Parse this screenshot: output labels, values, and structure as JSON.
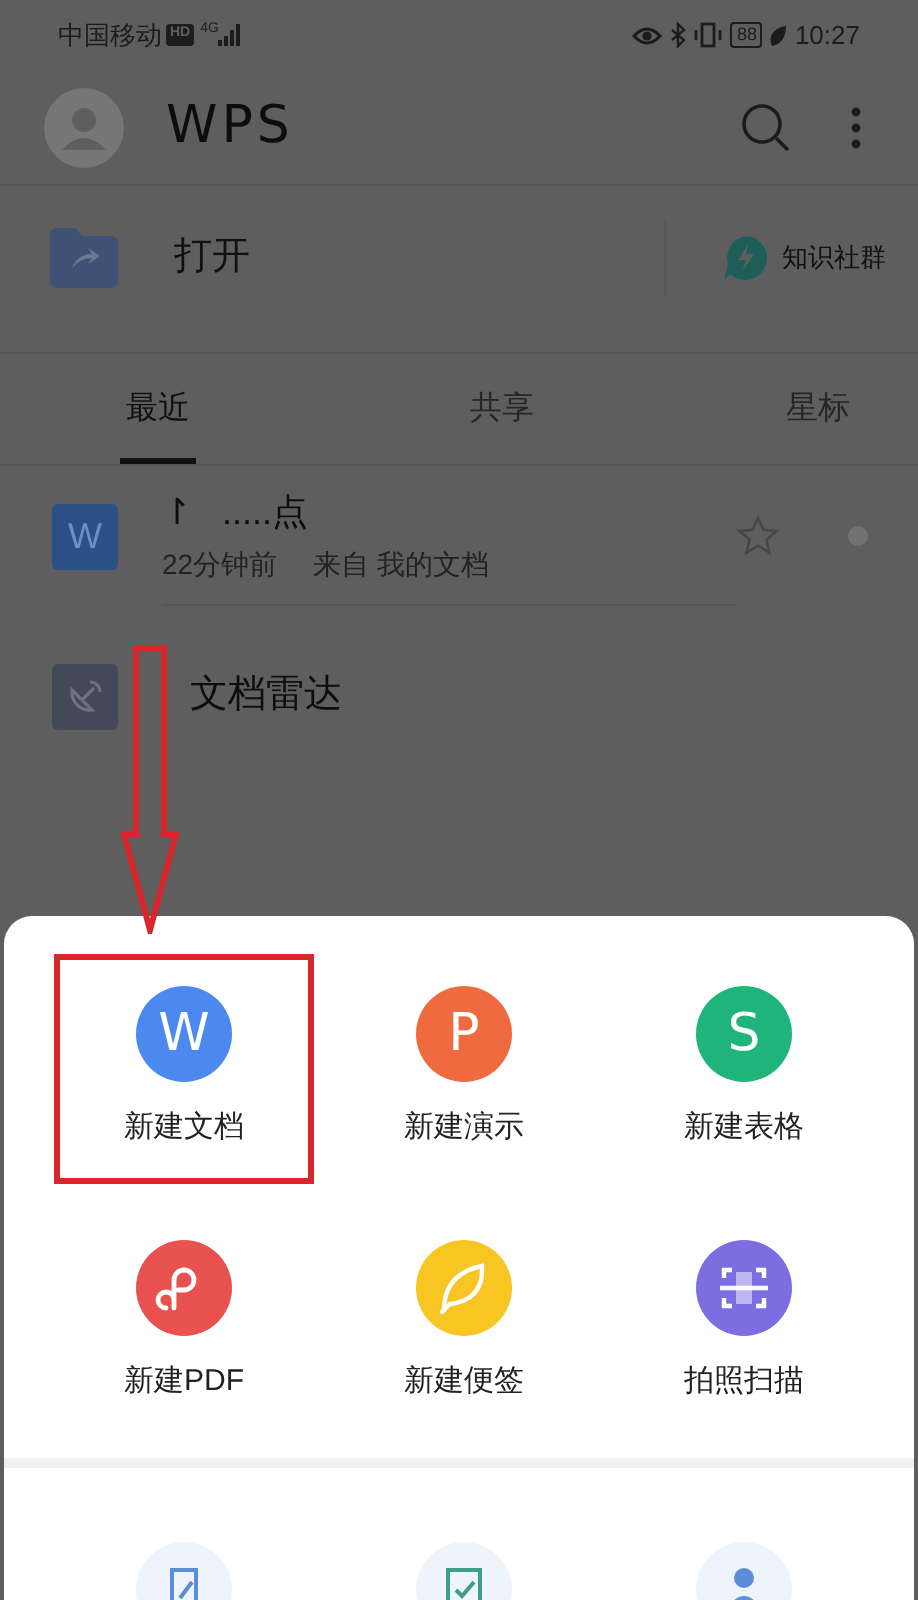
{
  "status_bar": {
    "carrier": "中国移动",
    "hd_badge": "HD",
    "network": "4G",
    "battery": "88",
    "time": "10:27"
  },
  "app_bar": {
    "logo": "WPS"
  },
  "open_row": {
    "label": "打开",
    "community": "知识社群"
  },
  "tabs": [
    {
      "label": "最近",
      "selected": true
    },
    {
      "label": "共享",
      "selected": false
    },
    {
      "label": "星标",
      "selected": false
    }
  ],
  "files": [
    {
      "kind": "writer",
      "glyph": "W",
      "name": "↾   .....点",
      "time": "22分钟前",
      "source": "来自 我的文档",
      "starred": false
    },
    {
      "kind": "radar",
      "name": "文档雷达"
    }
  ],
  "new_menu": [
    {
      "kind": "letter",
      "glyph": "W",
      "label": "新建文档",
      "color": "#4b89f0",
      "highlighted": true
    },
    {
      "kind": "letter",
      "glyph": "P",
      "label": "新建演示",
      "color": "#f06a3f",
      "highlighted": false
    },
    {
      "kind": "letter",
      "glyph": "S",
      "label": "新建表格",
      "color": "#1fb57a",
      "highlighted": false
    },
    {
      "kind": "pdf",
      "label": "新建PDF",
      "color": "#e9514f",
      "highlighted": false
    },
    {
      "kind": "note",
      "label": "新建便签",
      "color": "#f7c623",
      "highlighted": false
    },
    {
      "kind": "scan",
      "label": "拍照扫描",
      "color": "#7c6de0",
      "highlighted": false
    }
  ]
}
